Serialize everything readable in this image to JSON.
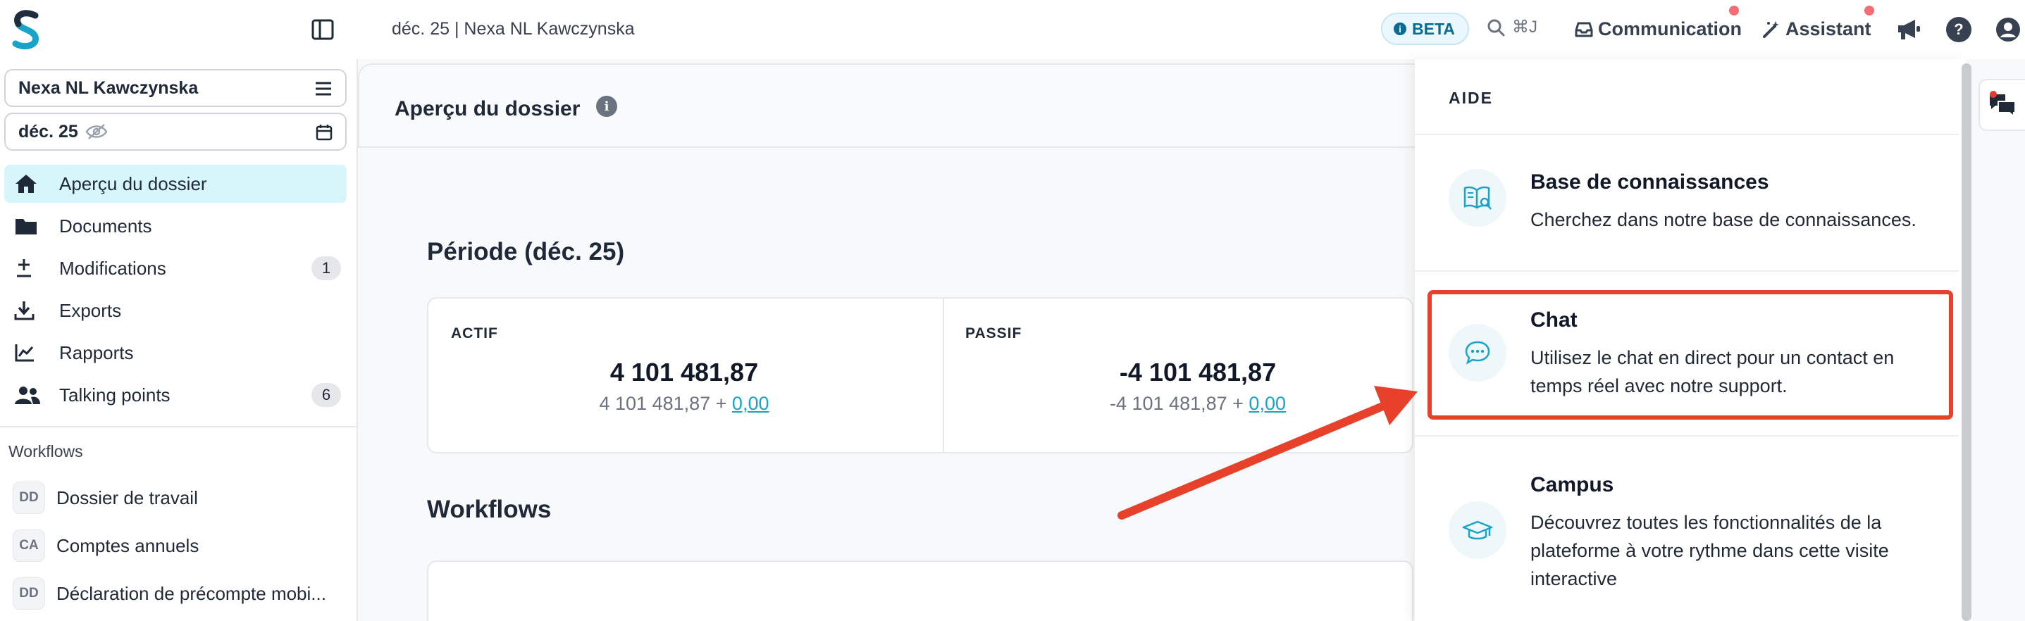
{
  "topbar": {
    "breadcrumb": "déc. 25 | Nexa NL Kawczynska",
    "beta_label": "BETA",
    "search_shortcut": "⌘J",
    "communication_label": "Communication",
    "assistant_label": "Assistant",
    "help_glyph": "?"
  },
  "sidebar": {
    "client_select": "Nexa NL Kawczynska",
    "period_select": "déc. 25",
    "items": [
      {
        "label": "Aperçu du dossier",
        "icon": "home-icon",
        "active": true
      },
      {
        "label": "Documents",
        "icon": "folder-icon"
      },
      {
        "label": "Modifications",
        "icon": "plus-minus-icon",
        "count": "1"
      },
      {
        "label": "Exports",
        "icon": "download-icon"
      },
      {
        "label": "Rapports",
        "icon": "chart-line-icon"
      },
      {
        "label": "Talking points",
        "icon": "users-icon",
        "count": "6"
      }
    ],
    "workflows_heading": "Workflows",
    "workflows": [
      {
        "badge": "DD",
        "label": "Dossier de travail"
      },
      {
        "badge": "CA",
        "label": "Comptes annuels"
      },
      {
        "badge": "DD",
        "label": "Déclaration de précompte mobi..."
      }
    ]
  },
  "main": {
    "page_title": "Aperçu du dossier",
    "period_title": "Période (déc. 25)",
    "actif": {
      "label": "ACTIF",
      "value": "4 101 481,87",
      "sub": "4 101 481,87 + ",
      "link": "0,00"
    },
    "passif": {
      "label": "PASSIF",
      "value": "-4 101 481,87",
      "sub": "-4 101 481,87 + ",
      "link": "0,00"
    },
    "workflows_title": "Workflows"
  },
  "help_panel": {
    "heading": "AIDE",
    "items": [
      {
        "title": "Base de connaissances",
        "desc": "Cherchez dans notre base de connaissances.",
        "icon": "book-search-icon"
      },
      {
        "title": "Chat",
        "desc": "Utilisez le chat en direct pour un contact en temps réel avec notre support.",
        "icon": "chat-bubble-icon"
      },
      {
        "title": "Campus",
        "desc": "Découvrez toutes les fonctionnalités de la plateforme à votre rythme dans cette visite interactive",
        "icon": "graduation-cap-icon"
      }
    ]
  },
  "colors": {
    "accent": "#1aa3c9",
    "active_nav": "#d6f6fb",
    "annotation": "#e8412b",
    "notification": "#f26d74"
  }
}
